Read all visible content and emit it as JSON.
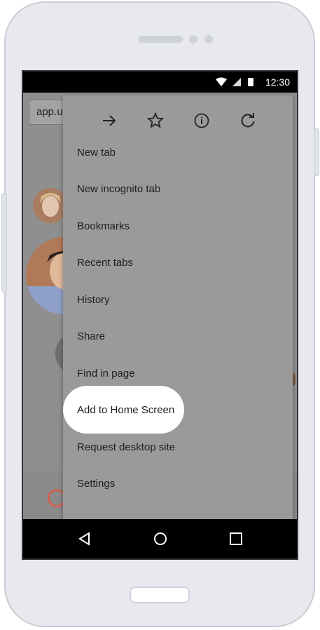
{
  "status_bar": {
    "time": "12:30",
    "icons": [
      "wifi-icon",
      "signal-icon",
      "battery-icon"
    ]
  },
  "browser": {
    "address_text": "app.u"
  },
  "menu": {
    "toolbar": [
      "forward-icon",
      "star-icon",
      "info-icon",
      "reload-icon"
    ],
    "items": [
      {
        "label": "New tab"
      },
      {
        "label": "New incognito tab"
      },
      {
        "label": "Bookmarks"
      },
      {
        "label": "Recent tabs"
      },
      {
        "label": "History"
      },
      {
        "label": "Share"
      },
      {
        "label": "Find in page"
      },
      {
        "label": "Add to Home Screen",
        "highlighted": true
      },
      {
        "label": "Request desktop site"
      },
      {
        "label": "Settings"
      }
    ]
  },
  "nav": [
    "back-icon",
    "home-icon",
    "recents-icon"
  ],
  "colors": {
    "menu_bg": "#9a9a9a",
    "highlight": "#ffffff",
    "phone_body": "#e7e9ef",
    "loader_accent": "#d0624e"
  }
}
